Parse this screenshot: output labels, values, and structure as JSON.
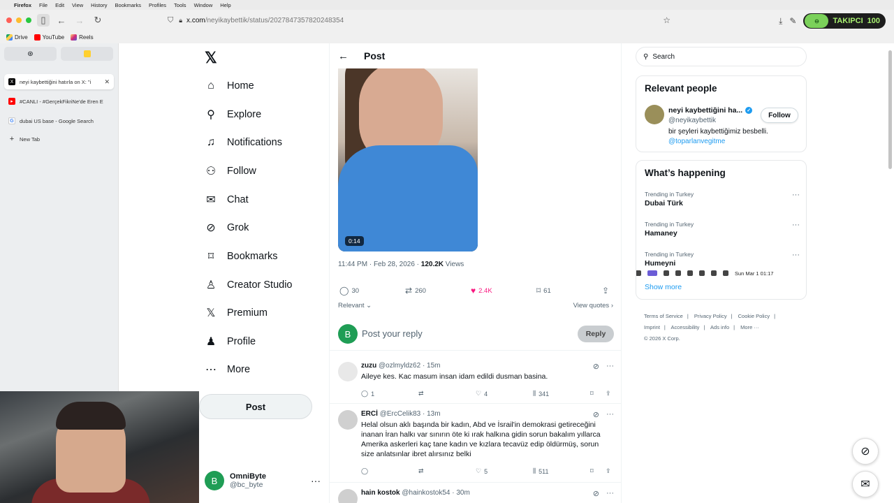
{
  "menubar": {
    "app": "Firefox",
    "items": [
      "File",
      "Edit",
      "View",
      "History",
      "Bookmarks",
      "Profiles",
      "Tools",
      "Window",
      "Help"
    ],
    "clock": "Sun Mar 1  01:17"
  },
  "browser": {
    "url_host": "x.com",
    "url_path": "/neyikaybettik/status/2027847357820248354",
    "extension_label": "TAKIPCI",
    "extension_badge": "100"
  },
  "bookmarks": [
    "Drive",
    "YouTube",
    "Reels"
  ],
  "side_tabs": [
    {
      "title": "neyi kaybettiğini hatırla on X: \"i",
      "active": true
    },
    {
      "title": "#CANLI - #GerçekFikriNe'de Eren E",
      "active": false
    },
    {
      "title": "dubai US base - Google Search",
      "active": false
    },
    {
      "title": "New Tab",
      "active": false
    }
  ],
  "nav": {
    "items": [
      "Home",
      "Explore",
      "Notifications",
      "Follow",
      "Chat",
      "Grok",
      "Bookmarks",
      "Creator Studio",
      "Premium",
      "Profile",
      "More"
    ],
    "post_button": "Post",
    "account_name": "OmniByte",
    "account_handle": "@bc_byte",
    "account_initial": "B"
  },
  "post": {
    "header": "Post",
    "video_duration": "0:14",
    "time": "11:44 PM · Feb 28, 2026 · ",
    "views_count": "120.2K",
    "views_label": " Views",
    "replies": "30",
    "reposts": "260",
    "likes": "2.4K",
    "bookmarks": "61",
    "sort_label": "Relevant",
    "view_quotes": "View quotes",
    "reply_placeholder": "Post your reply",
    "reply_button": "Reply"
  },
  "replies": [
    {
      "name": "zuzu",
      "handle": "@ozlmyldz62 · 15m",
      "text": "Aileye kes. Kac masum insan idam edildi dusman basina.",
      "replies": "1",
      "reposts": "",
      "likes": "4",
      "views": "341"
    },
    {
      "name": "ERCİ",
      "handle": "@ErcCelik83 · 13m",
      "text": "Helal olsun aklı başında bir kadın, Abd ve İsrail'in demokrasi getireceğini inanan İran halkı var sınırın öte ki ırak halkına gidin sorun bakalım yıllarca Amerika askerleri kaç tane kadın ve kızlara  tecavüz edip öldürmüş, sorun size anlatsınlar ibret alırsınız belki",
      "replies": "",
      "reposts": "",
      "likes": "5",
      "views": "511"
    },
    {
      "name": "hain kostok",
      "handle": "@hainkostok54 · 30m",
      "text": "",
      "replies": "",
      "reposts": "",
      "likes": "",
      "views": ""
    }
  ],
  "search": {
    "placeholder": "Search"
  },
  "relevant": {
    "title": "Relevant people",
    "name": "neyi kaybettiğini ha...",
    "handle": "@neyikaybettik",
    "bio": "bir şeyleri kaybettiğimiz besbelli.",
    "link": "@toparlanvegitme",
    "follow": "Follow"
  },
  "happening": {
    "title": "What’s happening",
    "trends": [
      {
        "context": "Trending in Turkey",
        "name": "Dubai Türk"
      },
      {
        "context": "Trending in Turkey",
        "name": "Hamaney"
      },
      {
        "context": "Trending in Turkey",
        "name": "Humeyni"
      }
    ],
    "show_more": "Show more"
  },
  "footer": {
    "links": [
      "Terms of Service",
      "|",
      "Privacy Policy",
      "|",
      "Cookie Policy",
      "|",
      "Imprint",
      "|",
      "Accessibility",
      "|",
      "Ads info",
      "|",
      "More ···"
    ],
    "copyright": "© 2026 X Corp."
  }
}
